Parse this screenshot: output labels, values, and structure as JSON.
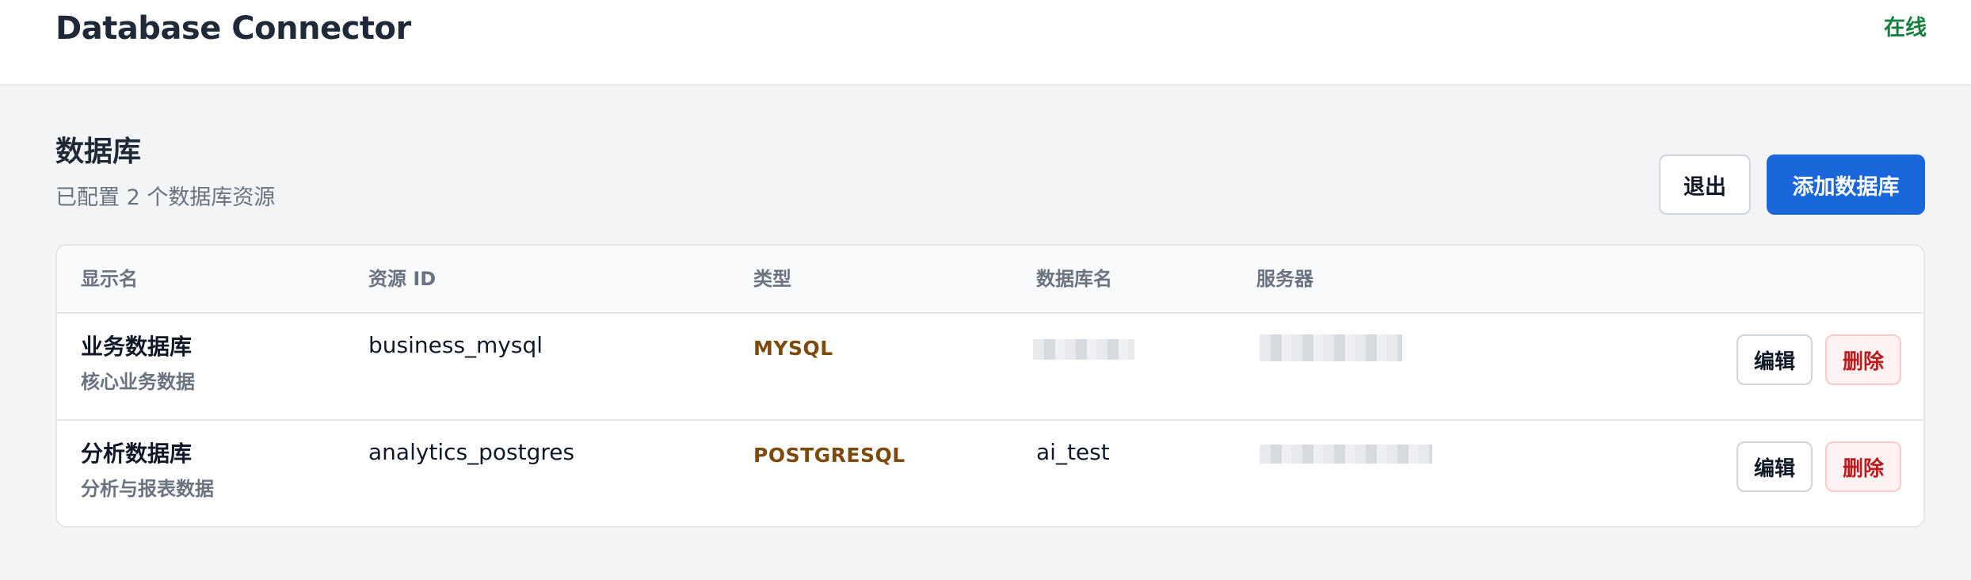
{
  "header": {
    "title": "Database Connector",
    "status": "在线"
  },
  "section": {
    "title": "数据库",
    "subtitle": "已配置 2 个数据库资源",
    "logout_label": "退出",
    "add_label": "添加数据库"
  },
  "table": {
    "columns": [
      "显示名",
      "资源 ID",
      "类型",
      "数据库名",
      "服务器"
    ],
    "rows": [
      {
        "display_name": "业务数据库",
        "description": "核心业务数据",
        "resource_id": "business_mysql",
        "type": "MYSQL",
        "database": "",
        "server": "",
        "edit_label": "编辑",
        "delete_label": "删除"
      },
      {
        "display_name": "分析数据库",
        "description": "分析与报表数据",
        "resource_id": "analytics_postgres",
        "type": "POSTGRESQL",
        "database": "ai_test",
        "server": "",
        "edit_label": "编辑",
        "delete_label": "删除"
      }
    ]
  },
  "colors": {
    "primary": "#1a66db",
    "status_online": "#15803d",
    "type_text": "#7c4a0a",
    "danger": "#b91c1c"
  }
}
